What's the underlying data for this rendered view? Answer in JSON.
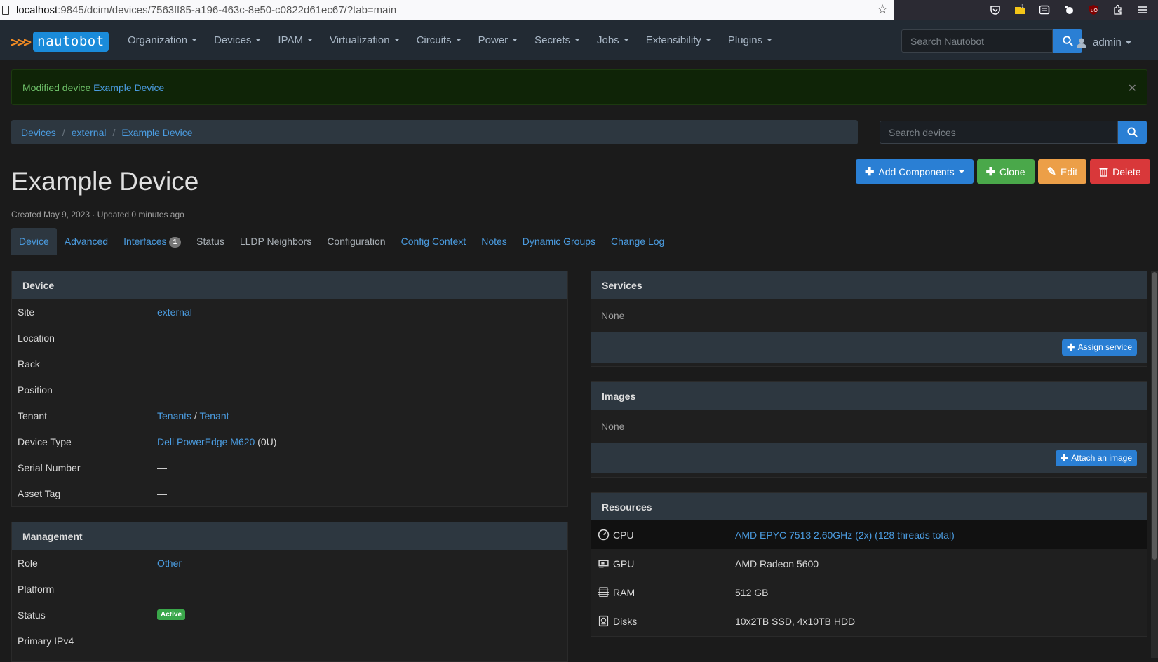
{
  "browser": {
    "url_host": "localhost",
    "url_rest": ":9845/dcim/devices/7563ff85-a196-463c-8e50-c0822d61ec67/?tab=main"
  },
  "navbar": {
    "brand": "nautobot",
    "menu": [
      "Organization",
      "Devices",
      "IPAM",
      "Virtualization",
      "Circuits",
      "Power",
      "Secrets",
      "Jobs",
      "Extensibility",
      "Plugins"
    ],
    "search_placeholder": "Search Nautobot",
    "user": "admin"
  },
  "alert": {
    "prefix": "Modified device ",
    "link": "Example Device"
  },
  "breadcrumb": [
    "Devices",
    "external",
    "Example Device"
  ],
  "side_search_placeholder": "Search devices",
  "title": "Example Device",
  "meta": "Created May 9, 2023 · Updated 0 minutes ago",
  "actions": {
    "add_components": "Add Components",
    "clone": "Clone",
    "edit": "Edit",
    "delete": "Delete"
  },
  "tabs": {
    "device": "Device",
    "advanced": "Advanced",
    "interfaces": "Interfaces",
    "interfaces_count": "1",
    "status": "Status",
    "lldp": "LLDP Neighbors",
    "configuration": "Configuration",
    "config_context": "Config Context",
    "notes": "Notes",
    "dynamic_groups": "Dynamic Groups",
    "change_log": "Change Log"
  },
  "device_panel": {
    "heading": "Device",
    "site_label": "Site",
    "site_value": "external",
    "location_label": "Location",
    "location_value": "—",
    "rack_label": "Rack",
    "rack_value": "—",
    "position_label": "Position",
    "position_value": "—",
    "tenant_label": "Tenant",
    "tenant_group": "Tenants",
    "tenant_sep": " / ",
    "tenant_value": "Tenant",
    "device_type_label": "Device Type",
    "device_type_value": "Dell PowerEdge M620",
    "device_type_suffix": " (0U)",
    "serial_label": "Serial Number",
    "serial_value": "—",
    "asset_label": "Asset Tag",
    "asset_value": "—"
  },
  "management_panel": {
    "heading": "Management",
    "role_label": "Role",
    "role_value": "Other",
    "platform_label": "Platform",
    "platform_value": "—",
    "status_label": "Status",
    "status_value": "Active",
    "ipv4_label": "Primary IPv4",
    "ipv4_value": "—"
  },
  "services_panel": {
    "heading": "Services",
    "empty": "None",
    "button": "Assign service"
  },
  "images_panel": {
    "heading": "Images",
    "empty": "None",
    "button": "Attach an image"
  },
  "resources_panel": {
    "heading": "Resources",
    "cpu_label": "CPU",
    "cpu_value": "AMD EPYC 7513 2.60GHz (2x) (128 threads total)",
    "gpu_label": "GPU",
    "gpu_value": "AMD Radeon 5600",
    "ram_label": "RAM",
    "ram_value": "512 GB",
    "disks_label": "Disks",
    "disks_value": "10x2TB SSD, 4x10TB HDD"
  }
}
